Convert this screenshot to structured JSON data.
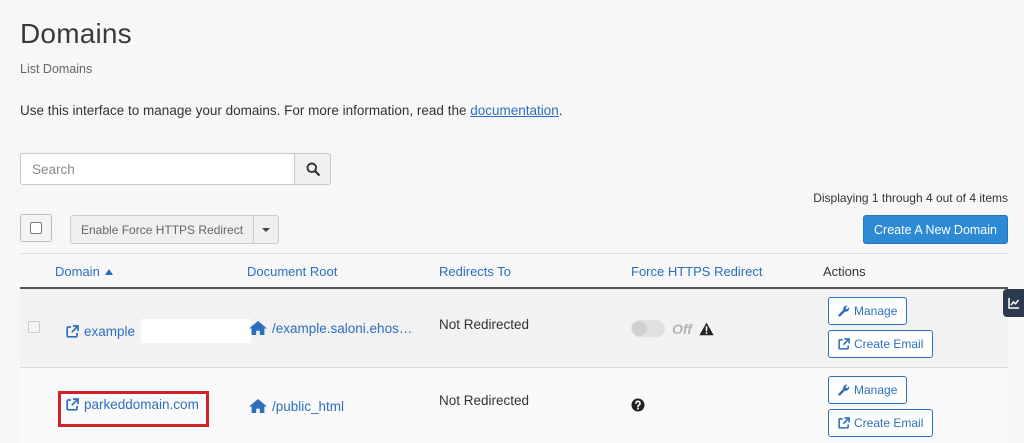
{
  "page": {
    "title": "Domains",
    "subtitle": "List Domains",
    "intro_text": "Use this interface to manage your domains. For more information, read the ",
    "intro_link": "documentation",
    "intro_end": "."
  },
  "search": {
    "placeholder": "Search",
    "value": "",
    "button_icon": "search-icon"
  },
  "pagination": {
    "summary": "Displaying 1 through 4 out of 4 items"
  },
  "toolbar": {
    "bulk_action_label": "Enable Force HTTPS Redirect",
    "create_label": "Create A New Domain"
  },
  "table": {
    "columns": [
      "Domain",
      "Document Root",
      "Redirects To",
      "Force HTTPS Redirect",
      "Actions"
    ],
    "sort_column": "Domain",
    "sort_direction": "ascending",
    "rows": [
      {
        "domain": "example",
        "document_root": "/example.saloni.ehos…",
        "redirects_to": "Not Redirected",
        "force_https": "Off",
        "force_https_status": "warning",
        "actions": [
          "Manage",
          "Create Email"
        ]
      },
      {
        "domain": "parkeddomain.com",
        "document_root": "/public_html",
        "redirects_to": "Not Redirected",
        "force_https": "",
        "force_https_status": "help",
        "actions": [
          "Manage",
          "Create Email"
        ]
      }
    ]
  },
  "colors": {
    "accent": "#2b6fc0",
    "primary_button": "#2d8ad5",
    "highlight": "#d4202a",
    "side_tab": "#2b3a4d"
  },
  "icons": [
    "search-icon",
    "external-link-icon",
    "home-icon",
    "warning-icon",
    "question-circle-icon",
    "wrench-icon",
    "external-link-icon",
    "chart-icon",
    "caret-down-icon",
    "sort-caret-up-icon"
  ]
}
